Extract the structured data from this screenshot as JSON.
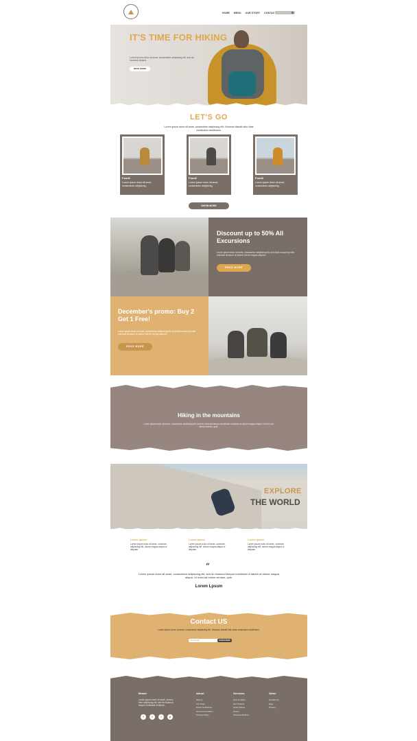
{
  "header": {
    "nav": [
      "HOME",
      "MENU",
      "OUR STORY",
      "CONTACT US"
    ]
  },
  "hero": {
    "title": "IT'S TIME FOR HIKING",
    "desc": "Lorem ipsum dolor sit amet, consectetur adipiscing elit, sed do eiusmod tempor.",
    "button": "READ MORE"
  },
  "letsgo": {
    "title": "LET'S GO",
    "desc": "Lorem ipsum dolor sit amet, consectetur adipiscing elit. Vivamus blandit odio vitae vestibulum vestibulum.",
    "cards": [
      {
        "title": "Food1",
        "text": "Lorem ipsum dolor sit amet, consectetur adipiscing."
      },
      {
        "title": "Food2",
        "text": "Lorem ipsum dolor sit amet, consectetur adipiscing."
      },
      {
        "title": "Food3",
        "text": "Lorem ipsum dolor sit amet, consectetur adipiscing."
      }
    ],
    "show_more": "SHOW MORE"
  },
  "promo1": {
    "title": "Discount up to 50% All Excursions",
    "desc": "Lorem ipsum dolor sit amet, consectetur adipiscing elit, sed diam nonummy nibh euismod tincidunt ut laoreet dolore magna aliquam.",
    "button": "READ MORE"
  },
  "promo2": {
    "title": "December's promo: Buy 2 Get 1 Free!",
    "desc": "Lorem ipsum dolor sit amet, consectetur adipiscing elit, sed diam nonummy nibh euismod tincidunt ut laoreet dolore magna aliquam.",
    "button": "READ MORE"
  },
  "hiking": {
    "title": "Hiking in the mountains",
    "desc": "Lorem ipsum dolor sit amet, consectetur adipiscing elit, sed do eiusmod tempor incididunt ut labore et dolore magna aliqua. Ut enim ad minim veniam, quis."
  },
  "explore": {
    "line1": "EXPLORE",
    "line2": "THE WORLD"
  },
  "features": [
    {
      "title": "Lorem Ipsum",
      "text": "Lorem ipsum dolor sit amet, consecte adipiscing elit, dolore magna aliqua ut aliquam."
    },
    {
      "title": "Lorem Ipsum",
      "text": "Lorem ipsum dolor sit amet, consecte adipiscing elit, dolore magna aliqua ut aliquam."
    },
    {
      "title": "Lorem Ipsum",
      "text": "Lorem ipsum dolor sit amet, consecte adipiscing elit, dolore magna aliqua ut aliquam."
    }
  ],
  "quote": {
    "mark": "“",
    "text": "Lorem ipsum dolor sit amet, consectetur adipiscing elit, sed do eiusmod tempor incididunt ut labore et dolore magna aliqua. Ut enim ad minim veniam, quis.",
    "author": "Lorem Lpsum"
  },
  "contact": {
    "title": "Contact US",
    "desc": "Lorem ipsum dolor sit amet, consectetur adipiscing elit. Vivamus blandit odio vitae vestibulum vestibulum.",
    "placeholder": "Your Email",
    "button": "SUBSCRIBE"
  },
  "footer": {
    "brand": {
      "title": "Brand",
      "text": "Lorem ipsum dolor sit amet, consec tetur adipiscing elit, sed do eiusmod tempor incididunt ut labore."
    },
    "about": {
      "title": "About",
      "items": [
        "History",
        "Our Team",
        "Brand Guidelines",
        "Terms & Condition",
        "Privacy Policy"
      ]
    },
    "services": {
      "title": "Services",
      "items": [
        "How to Order",
        "Our Product",
        "Order Status",
        "Promo",
        "Payment Method"
      ]
    },
    "other": {
      "title": "Other",
      "items": [
        "Contact Us",
        "Help",
        "Privacy"
      ]
    },
    "socials": [
      "f",
      "t",
      "i",
      "p"
    ]
  },
  "colors": {
    "accent": "#e0a64d",
    "brand": "#7a6f68",
    "sand": "#e0b272"
  }
}
